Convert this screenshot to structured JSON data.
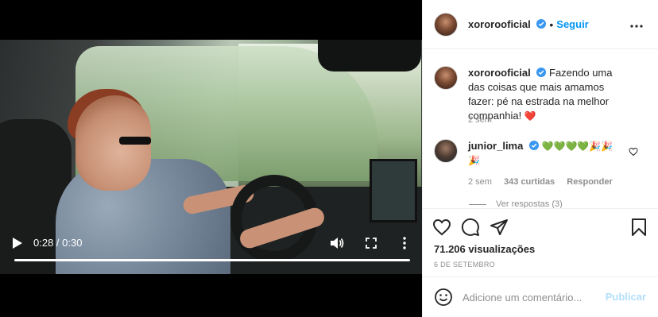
{
  "video": {
    "time": "0:28 / 0:30",
    "progress": 0.933,
    "play_icon": "play-icon",
    "volume_icon": "volume-icon",
    "fullscreen_icon": "fullscreen-icon",
    "more_icon": "more-vertical-icon"
  },
  "header": {
    "username": "xororooficial",
    "dot": "•",
    "follow_label": "Seguir",
    "more_icon": "more-horizontal-icon"
  },
  "caption": {
    "username": "xororooficial",
    "text": "Fazendo uma das coisas que mais amamos fazer: pé na estrada na melhor companhia!",
    "emoji": "❤️",
    "time": "2 sem"
  },
  "comment": {
    "username": "junior_lima",
    "emojis": "💚💚💚💚🎉🎉🎉",
    "time": "2 sem",
    "likes": "343 curtidas",
    "reply_label": "Responder",
    "view_replies": "Ver respostas (3)"
  },
  "actions": {
    "views": "71.206 visualizações",
    "date": "6 DE SETEMBRO"
  },
  "add_comment": {
    "placeholder": "Adicione um comentário...",
    "publish_label": "Publicar"
  },
  "colors": {
    "accent": "#0095f6",
    "publish_disabled": "#b2dffc",
    "like_red": "#ed4956"
  }
}
